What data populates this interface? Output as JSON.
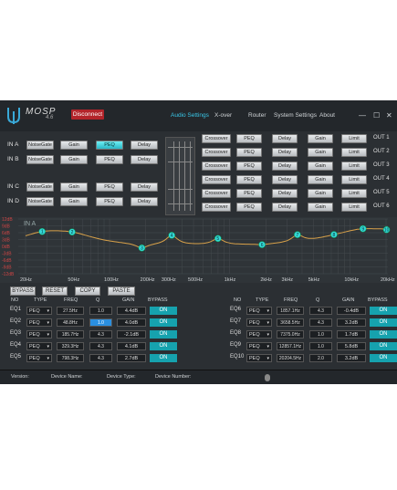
{
  "app": {
    "brand": "MOSP",
    "model": "4.6",
    "disconnect_label": "Disconnect"
  },
  "nav": {
    "audio_settings": "Audio Settings",
    "xover": "X-over",
    "router": "Router",
    "system_settings": "System Settings",
    "about": "About"
  },
  "window": {
    "min": "—",
    "max": "☐",
    "close": "✕"
  },
  "inputs": [
    {
      "label": "IN A",
      "buttons": [
        "NoiseGate",
        "Gain",
        "PEQ",
        "Delay"
      ],
      "active": 2
    },
    {
      "label": "IN B",
      "buttons": [
        "NoiseGate",
        "Gain",
        "PEQ",
        "Delay"
      ],
      "active": -1
    },
    {
      "label": "IN C",
      "buttons": [
        "NoiseGate",
        "Gain",
        "PEQ",
        "Delay"
      ],
      "active": -1
    },
    {
      "label": "IN D",
      "buttons": [
        "NoiseGate",
        "Gain",
        "PEQ",
        "Delay"
      ],
      "active": -1
    }
  ],
  "outputs": [
    {
      "label": "OUT 1",
      "buttons": [
        "Crossover",
        "PEQ",
        "Delay",
        "Gain",
        "Limit"
      ]
    },
    {
      "label": "OUT 2",
      "buttons": [
        "Crossover",
        "PEQ",
        "Delay",
        "Gain",
        "Limit"
      ]
    },
    {
      "label": "OUT 3",
      "buttons": [
        "Crossover",
        "PEQ",
        "Delay",
        "Gain",
        "Limit"
      ]
    },
    {
      "label": "OUT 4",
      "buttons": [
        "Crossover",
        "PEQ",
        "Delay",
        "Gain",
        "Limit"
      ]
    },
    {
      "label": "OUT 5",
      "buttons": [
        "Crossover",
        "PEQ",
        "Delay",
        "Gain",
        "Limit"
      ]
    },
    {
      "label": "OUT 6",
      "buttons": [
        "Crossover",
        "PEQ",
        "Delay",
        "Gain",
        "Limit"
      ]
    }
  ],
  "graph": {
    "channel_label": "IN A",
    "y_ticks": [
      "12dB",
      "9dB",
      "6dB",
      "3dB",
      "0dB",
      "-3dB",
      "-6dB",
      "-9dB",
      "-12dB"
    ],
    "x_ticks": [
      "20Hz",
      "50Hz",
      "100Hz",
      "200Hz",
      "300Hz",
      "500Hz",
      "1kHz",
      "2kHz",
      "3kHz",
      "5kHz",
      "10kHz",
      "20kHz"
    ],
    "curve_color": "#d9a24a",
    "node_color": "#35d6d6",
    "nodes": [
      "1",
      "2",
      "3",
      "4",
      "5",
      "6",
      "7",
      "8",
      "9",
      "10"
    ]
  },
  "toolbar": {
    "bypass": "BYPASS",
    "reset": "RESET",
    "copy": "COPY",
    "paste": "PASTE"
  },
  "table_headers": {
    "no": "NO",
    "type": "TYPE",
    "freq": "FREQ",
    "q": "Q",
    "gain": "GAIN",
    "bypass": "BYPASS"
  },
  "eq_left": [
    {
      "no": "EQ1",
      "type": "PEQ",
      "freq": "27.5Hz",
      "q": "1.0",
      "gain": "4.4dB",
      "bypass": "ON"
    },
    {
      "no": "EQ2",
      "type": "PEQ",
      "freq": "48.8Hz",
      "q": "1.0",
      "gain": "4.0dB",
      "bypass": "ON"
    },
    {
      "no": "EQ3",
      "type": "PEQ",
      "freq": "185.7Hz",
      "q": "4.3",
      "gain": "-2.1dB",
      "bypass": "ON"
    },
    {
      "no": "EQ4",
      "type": "PEQ",
      "freq": "329.3Hz",
      "q": "4.3",
      "gain": "4.1dB",
      "bypass": "ON"
    },
    {
      "no": "EQ5",
      "type": "PEQ",
      "freq": "798.3Hz",
      "q": "4.3",
      "gain": "2.7dB",
      "bypass": "ON"
    }
  ],
  "eq_right": [
    {
      "no": "EQ6",
      "type": "PEQ",
      "freq": "1857.1Hz",
      "q": "4.3",
      "gain": "-0.4dB",
      "bypass": "ON"
    },
    {
      "no": "EQ7",
      "type": "PEQ",
      "freq": "3658.5Hz",
      "q": "4.3",
      "gain": "3.2dB",
      "bypass": "ON"
    },
    {
      "no": "EQ8",
      "type": "PEQ",
      "freq": "7375.0Hz",
      "q": "1.0",
      "gain": "1.7dB",
      "bypass": "ON"
    },
    {
      "no": "EQ9",
      "type": "PEQ",
      "freq": "12857.1Hz",
      "q": "1.0",
      "gain": "5.8dB",
      "bypass": "ON"
    },
    {
      "no": "EQ10",
      "type": "PEQ",
      "freq": "20204.5Hz",
      "q": "2.0",
      "gain": "3.2dB",
      "bypass": "ON"
    }
  ],
  "footer": {
    "version": "Version:",
    "device_name": "Device Name:",
    "device_type": "Device Type:",
    "device_number": "Device Number:"
  },
  "colors": {
    "accent": "#39c7e8",
    "on_button": "#16a2ae",
    "disconnect": "#b3242a",
    "curve": "#d9a24a"
  }
}
